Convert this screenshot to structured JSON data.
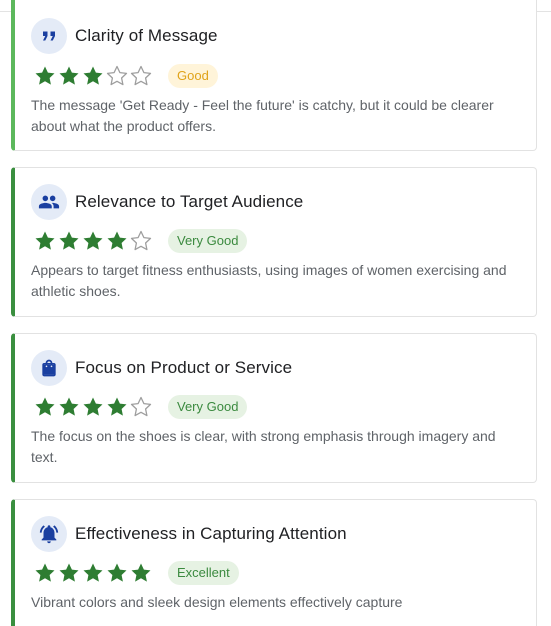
{
  "colors": {
    "star_filled": "#2e7d32",
    "star_empty": "#9e9e9e",
    "icon": "#1a3fa0",
    "icon_bg": "#e4ebf7",
    "accent_bar": "#3a8f3f",
    "good_badge_text": "#e0a31a",
    "very_good_badge_text": "#3b8a3f"
  },
  "cards": [
    {
      "icon": "quote-icon",
      "title": "Clarity of Message",
      "rating": 3,
      "max_rating": 5,
      "badge": "Good",
      "description": "The message 'Get Ready - Feel the future' is catchy, but it could be clearer about what the product offers."
    },
    {
      "icon": "people-icon",
      "title": "Relevance to Target Audience",
      "rating": 4,
      "max_rating": 5,
      "badge": "Very Good",
      "description": "Appears to target fitness enthusiasts, using images of women exercising and athletic shoes."
    },
    {
      "icon": "shopping-bag-icon",
      "title": "Focus on Product or Service",
      "rating": 4,
      "max_rating": 5,
      "badge": "Very Good",
      "description": "The focus on the shoes is clear, with strong emphasis through imagery and text."
    },
    {
      "icon": "bell-ringing-icon",
      "title": "Effectiveness in Capturing Attention",
      "rating": 5,
      "max_rating": 5,
      "badge": "Excellent",
      "description": "Vibrant colors and sleek design elements effectively capture"
    }
  ]
}
